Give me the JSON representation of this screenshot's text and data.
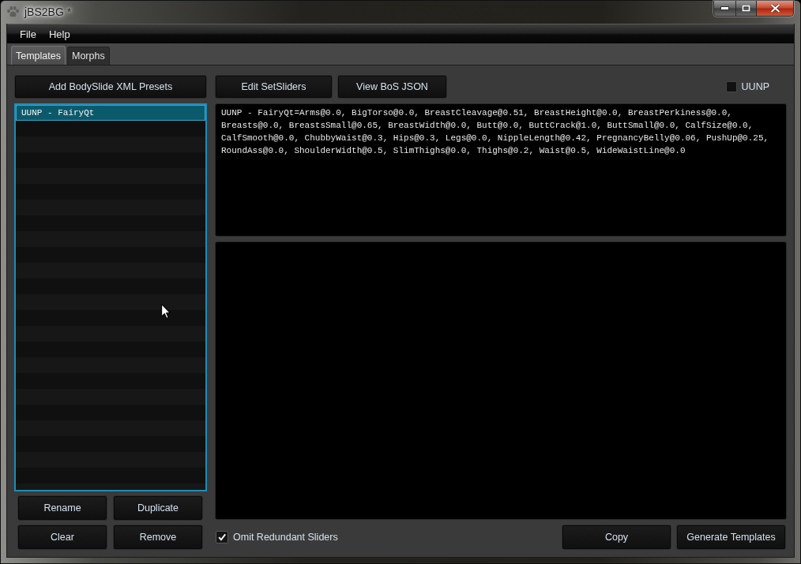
{
  "window": {
    "title": "jBS2BG *"
  },
  "menu": [
    {
      "label": "File"
    },
    {
      "label": "Help"
    }
  ],
  "tabs": [
    {
      "label": "Templates",
      "selected": true
    },
    {
      "label": "Morphs",
      "selected": false
    }
  ],
  "presets": {
    "add_button": "Add BodySlide XML Presets",
    "items": [
      {
        "label": "UUNP - FairyQt",
        "selected": true
      }
    ],
    "buttons": [
      {
        "label": "Rename"
      },
      {
        "label": "Duplicate"
      },
      {
        "label": "Clear"
      },
      {
        "label": "Remove"
      }
    ]
  },
  "toolbar": {
    "buttons": [
      {
        "label": "Edit SetSliders"
      },
      {
        "label": "View BoS JSON"
      }
    ],
    "uunp": {
      "label": "UUNP",
      "checked": false
    }
  },
  "template_text": "UUNP - FairyQt=Arms@0.0, BigTorso@0.0, BreastCleavage@0.51, BreastHeight@0.0, BreastPerkiness@0.0, Breasts@0.0, BreastsSmall@0.65, BreastWidth@0.0, Butt@0.0, ButtCrack@1.0, ButtSmall@0.0, CalfSize@0.0, CalfSmooth@0.0, ChubbyWaist@0.3, Hips@0.3, Legs@0.0, NippleLength@0.42, PregnancyBelly@0.06, PushUp@0.25, RoundAss@0.0, ShoulderWidth@0.5, SlimThighs@0.0, Thighs@0.2, Waist@0.5, WideWaistLine@0.0",
  "omit_redundant_sliders": {
    "label": "Omit Redundant Sliders",
    "checked": true
  },
  "actions": [
    {
      "label": "Copy"
    },
    {
      "label": "Generate Templates"
    }
  ]
}
